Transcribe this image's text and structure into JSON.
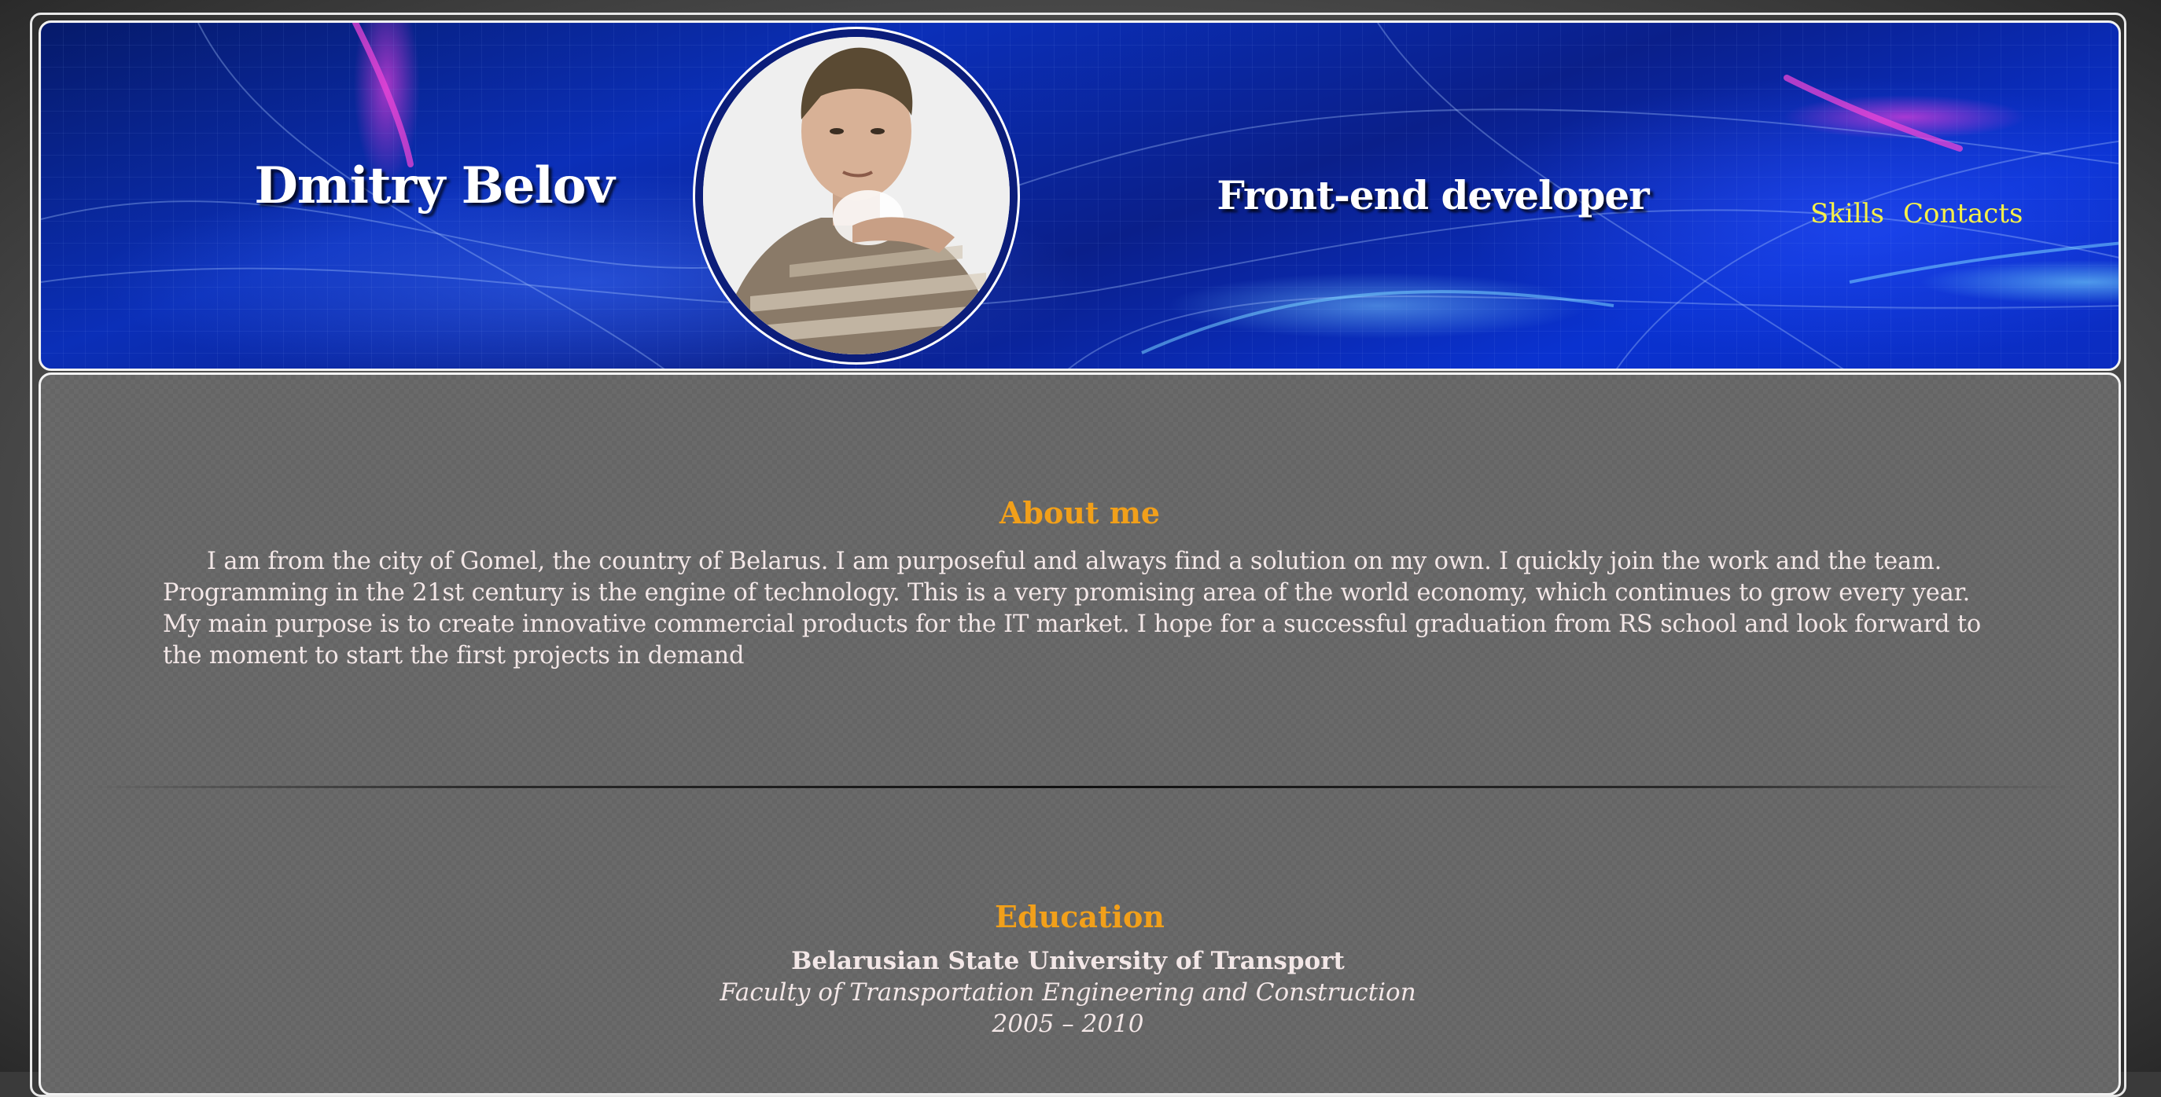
{
  "header": {
    "name": "Dmitry Belov",
    "role": "Front-end developer",
    "nav": {
      "skills_label": "Skills",
      "contacts_label": "Contacts"
    },
    "nav_link_color": "#f5f04a",
    "background_color": "#0b2fb8"
  },
  "about": {
    "heading": "About me",
    "text": "I am from the city of Gomel, the country of Belarus. I am purposeful and always find a solution on my own. I quickly join the work and the team. Programming in the 21st century is the engine of technology. This is a very promising area of the world economy, which continues to grow every year. My main purpose is to create innovative commercial products for the IT market. I hope for a successful graduation from RS school and look forward to the moment to start the first projects in demand"
  },
  "education": {
    "heading": "Education",
    "university": "Belarusian State University of Transport",
    "faculty": "Faculty of Transportation Engineering and Construction",
    "years": "2005 – 2010"
  },
  "colors": {
    "heading_accent": "#f2a01a",
    "body_text": "#f3e7e7",
    "content_background": "#6a6a6a"
  }
}
